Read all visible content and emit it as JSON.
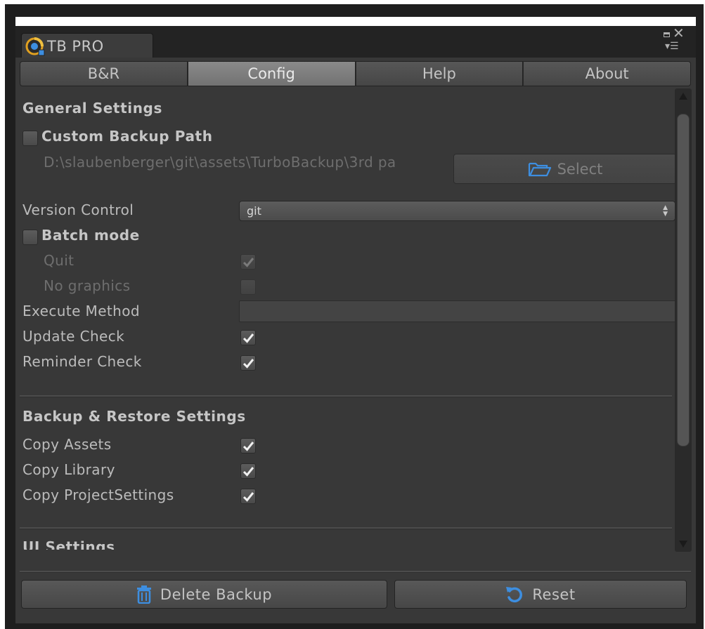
{
  "window": {
    "tab_title": "TB PRO",
    "logo_icon": "turbo-backup-logo-icon",
    "controls": [
      "maximize-icon",
      "close-icon",
      "menu-icon"
    ]
  },
  "toolbar": {
    "tabs": [
      {
        "label": "B&R",
        "active": false
      },
      {
        "label": "Config",
        "active": true
      },
      {
        "label": "Help",
        "active": false
      },
      {
        "label": "About",
        "active": false
      }
    ]
  },
  "general": {
    "heading": "General Settings",
    "custom_backup_path": {
      "label": "Custom Backup Path",
      "checked": false
    },
    "path_value": "D:\\slaubenberger\\git\\assets\\TurboBackup\\3rd pa",
    "select_button": {
      "label": "Select",
      "icon": "folder-open-icon"
    },
    "version_control": {
      "label": "Version Control",
      "value": "git"
    },
    "batch_mode": {
      "label": "Batch mode",
      "checked": false
    },
    "quit": {
      "label": "Quit",
      "checked": true,
      "disabled": true
    },
    "no_graphics": {
      "label": "No graphics",
      "checked": false,
      "disabled": true
    },
    "execute_method": {
      "label": "Execute Method",
      "value": ""
    },
    "update_check": {
      "label": "Update Check",
      "checked": true
    },
    "reminder_check": {
      "label": "Reminder Check",
      "checked": true
    }
  },
  "backup_restore": {
    "heading": "Backup & Restore Settings",
    "copy_assets": {
      "label": "Copy Assets",
      "checked": true
    },
    "copy_library": {
      "label": "Copy Library",
      "checked": true
    },
    "copy_project_settings": {
      "label": "Copy ProjectSettings",
      "checked": true
    }
  },
  "ui_settings": {
    "heading": "UI Settings"
  },
  "footer": {
    "delete_backup": {
      "label": "Delete Backup",
      "icon": "trash-icon"
    },
    "reset": {
      "label": "Reset",
      "icon": "reset-icon"
    }
  },
  "colors": {
    "panel": "#383838",
    "accent_icon": "#3d8ee0",
    "text": "#bcbcbc"
  }
}
